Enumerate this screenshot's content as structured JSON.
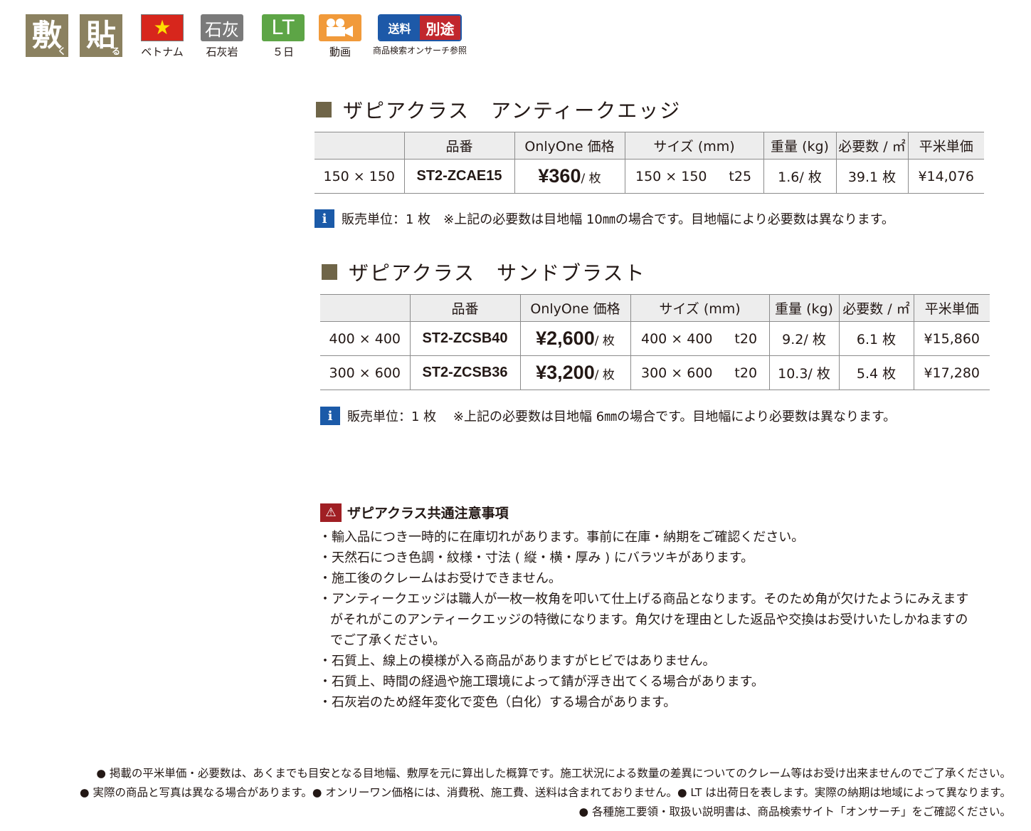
{
  "badges": {
    "construction": "敷",
    "construction_sub": "く",
    "adhesive": "貼",
    "adhesive_sub": "る",
    "origin_caption": "ベトナム",
    "material_icon_text": "石灰",
    "material_caption": "石灰岩",
    "lead_time_label": "LT",
    "lead_time_caption": "５日",
    "video_caption": "動画",
    "shipping_left": "送料",
    "shipping_right": "別途",
    "shipping_caption": "商品検索オンサーチ参照"
  },
  "section1": {
    "title": "ザピアクラス　アンティークエッジ",
    "headers": [
      "",
      "品番",
      "OnlyOne 価格",
      "サイズ (mm)",
      "重量 (kg)",
      "必要数 / ㎡",
      "平米単価"
    ],
    "rows": [
      {
        "name": "150 × 150",
        "code": "ST2-ZCAE15",
        "price": "¥360",
        "price_unit": "/ 枚",
        "size": "150 × 150",
        "thickness": "t25",
        "weight": "1.6/ 枚",
        "required": "39.1 枚",
        "sqm_price": "¥14,076"
      }
    ],
    "info": "販売単位：1 枚　※上記の必要数は目地幅 10㎜の場合です。目地幅により必要数は異なります。"
  },
  "section2": {
    "title": "ザピアクラス　サンドブラスト",
    "headers": [
      "",
      "品番",
      "OnlyOne 価格",
      "サイズ (mm)",
      "重量 (kg)",
      "必要数 / ㎡",
      "平米単価"
    ],
    "rows": [
      {
        "name": "400 × 400",
        "code": "ST2-ZCSB40",
        "price": "¥2,600",
        "price_unit": "/ 枚",
        "size": "400 × 400",
        "thickness": "t20",
        "weight": "9.2/ 枚",
        "required": "6.1 枚",
        "sqm_price": "¥15,860"
      },
      {
        "name": "300 × 600",
        "code": "ST2-ZCSB36",
        "price": "¥3,200",
        "price_unit": "/ 枚",
        "size": "300 × 600",
        "thickness": "t20",
        "weight": "10.3/ 枚",
        "required": "5.4 枚",
        "sqm_price": "¥17,280"
      }
    ],
    "info": "販売単位：1 枚　 ※上記の必要数は目地幅 6㎜の場合です。目地幅により必要数は異なります。"
  },
  "caution": {
    "title": "ザピアクラス共通注意事項",
    "items": [
      "・輸入品につき一時的に在庫切れがあります。事前に在庫・納期をご確認ください。",
      "・天然石につき色調・紋様・寸法 ( 縦・横・厚み ) にバラツキがあります。",
      "・施工後のクレームはお受けできません。",
      "・アンティークエッジは職人が一枚一枚角を叩いて仕上げる商品となります。そのため角が欠けたようにみえますがそれがこのアンティークエッジの特徴になります。角欠けを理由とした返品や交換はお受けいたしかねますのでご了承ください。",
      "・石質上、線上の模様が入る商品がありますがヒビではありません。",
      "・石質上、時間の経過や施工環境によって錆が浮き出てくる場合があります。",
      "・石灰岩のため経年変化で変色（白化）する場合があります。"
    ]
  },
  "footnotes": [
    "● 掲載の平米単価・必要数は、あくまでも目安となる目地幅、敷厚を元に算出した概算です。施工状況による数量の差異についてのクレーム等はお受け出来ませんのでご了承ください。",
    "● 実際の商品と写真は異なる場合があります。● オンリーワン価格には、消費税、施工費、送料は含まれておりません。● LT は出荷日を表します。実際の納期は地域によって異なります。",
    "● 各種施工要領・取扱い説明書は、商品検索サイト「オンサーチ」をご確認ください。"
  ],
  "colors": {
    "heading_square": "#6f6548",
    "kanji_badge": "#8b8160",
    "info_icon": "#1b5aa8",
    "warning_icon": "#a01f24",
    "table_header_bg": "#ededed"
  }
}
